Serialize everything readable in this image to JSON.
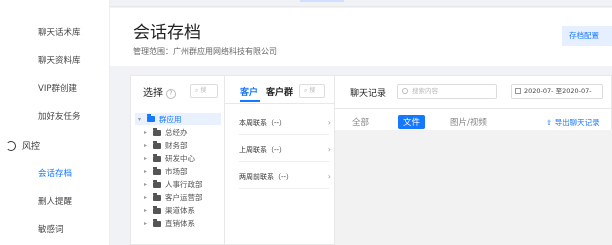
{
  "sidebar": {
    "top_hidden": "…",
    "items": [
      {
        "label": "聊天话术库",
        "active": false
      },
      {
        "label": "聊天资料库",
        "active": false
      },
      {
        "label": "VIP群创建",
        "active": false
      },
      {
        "label": "加好友任务",
        "active": false
      }
    ],
    "group": {
      "label": "风控",
      "icon": "risk-control-icon"
    },
    "sub_items": [
      {
        "label": "会话存档",
        "active": true
      },
      {
        "label": "删人提醒",
        "active": false
      },
      {
        "label": "敏感词",
        "active": false
      }
    ]
  },
  "header": {
    "title": "会话存档",
    "scope": "管理范围：广州群应用网络科技有限公司",
    "config_button": "存档配置"
  },
  "org_panel": {
    "title": "选择",
    "search_placeholder": "搜",
    "tree": [
      {
        "label": "群应用",
        "level": 0,
        "expanded": true
      },
      {
        "label": "总经办",
        "level": 1
      },
      {
        "label": "财务部",
        "level": 1
      },
      {
        "label": "研发中心",
        "level": 1
      },
      {
        "label": "市场部",
        "level": 1
      },
      {
        "label": "人事行政部",
        "level": 1
      },
      {
        "label": "客户运营部",
        "level": 1
      },
      {
        "label": "渠道体系",
        "level": 1
      },
      {
        "label": "直销体系",
        "level": 1
      }
    ]
  },
  "contact_panel": {
    "tabs": [
      {
        "label": "客户",
        "active": true
      },
      {
        "label": "客户群",
        "active": false
      }
    ],
    "search_placeholder": "搜",
    "periods": [
      {
        "label": "本周联系（--）"
      },
      {
        "label": "上周联系（--）"
      },
      {
        "label": "两周前联系（--）"
      }
    ]
  },
  "chat_panel": {
    "title": "聊天记录",
    "search_placeholder": "搜索内容",
    "date_range": "2020-07- 至2020-07-",
    "filter_tabs": [
      {
        "label": "全部",
        "active": false
      },
      {
        "label": "文件",
        "active": true
      },
      {
        "label": "图片/视频",
        "active": false
      }
    ],
    "export_label": "导出聊天记录"
  },
  "colors": {
    "accent": "#1677ff",
    "accent_light": "#e6efff"
  }
}
